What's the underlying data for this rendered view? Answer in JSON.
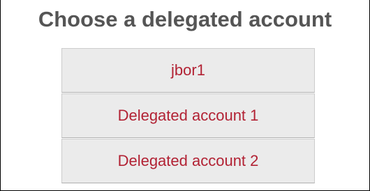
{
  "dialog": {
    "title": "Choose a delegated account",
    "accounts": [
      {
        "label": "jbor1"
      },
      {
        "label": "Delegated account 1"
      },
      {
        "label": "Delegated account 2"
      }
    ]
  },
  "colors": {
    "title_text": "#555555",
    "item_text": "#b22234",
    "item_background": "#ebebeb",
    "item_border": "#cccccc"
  }
}
